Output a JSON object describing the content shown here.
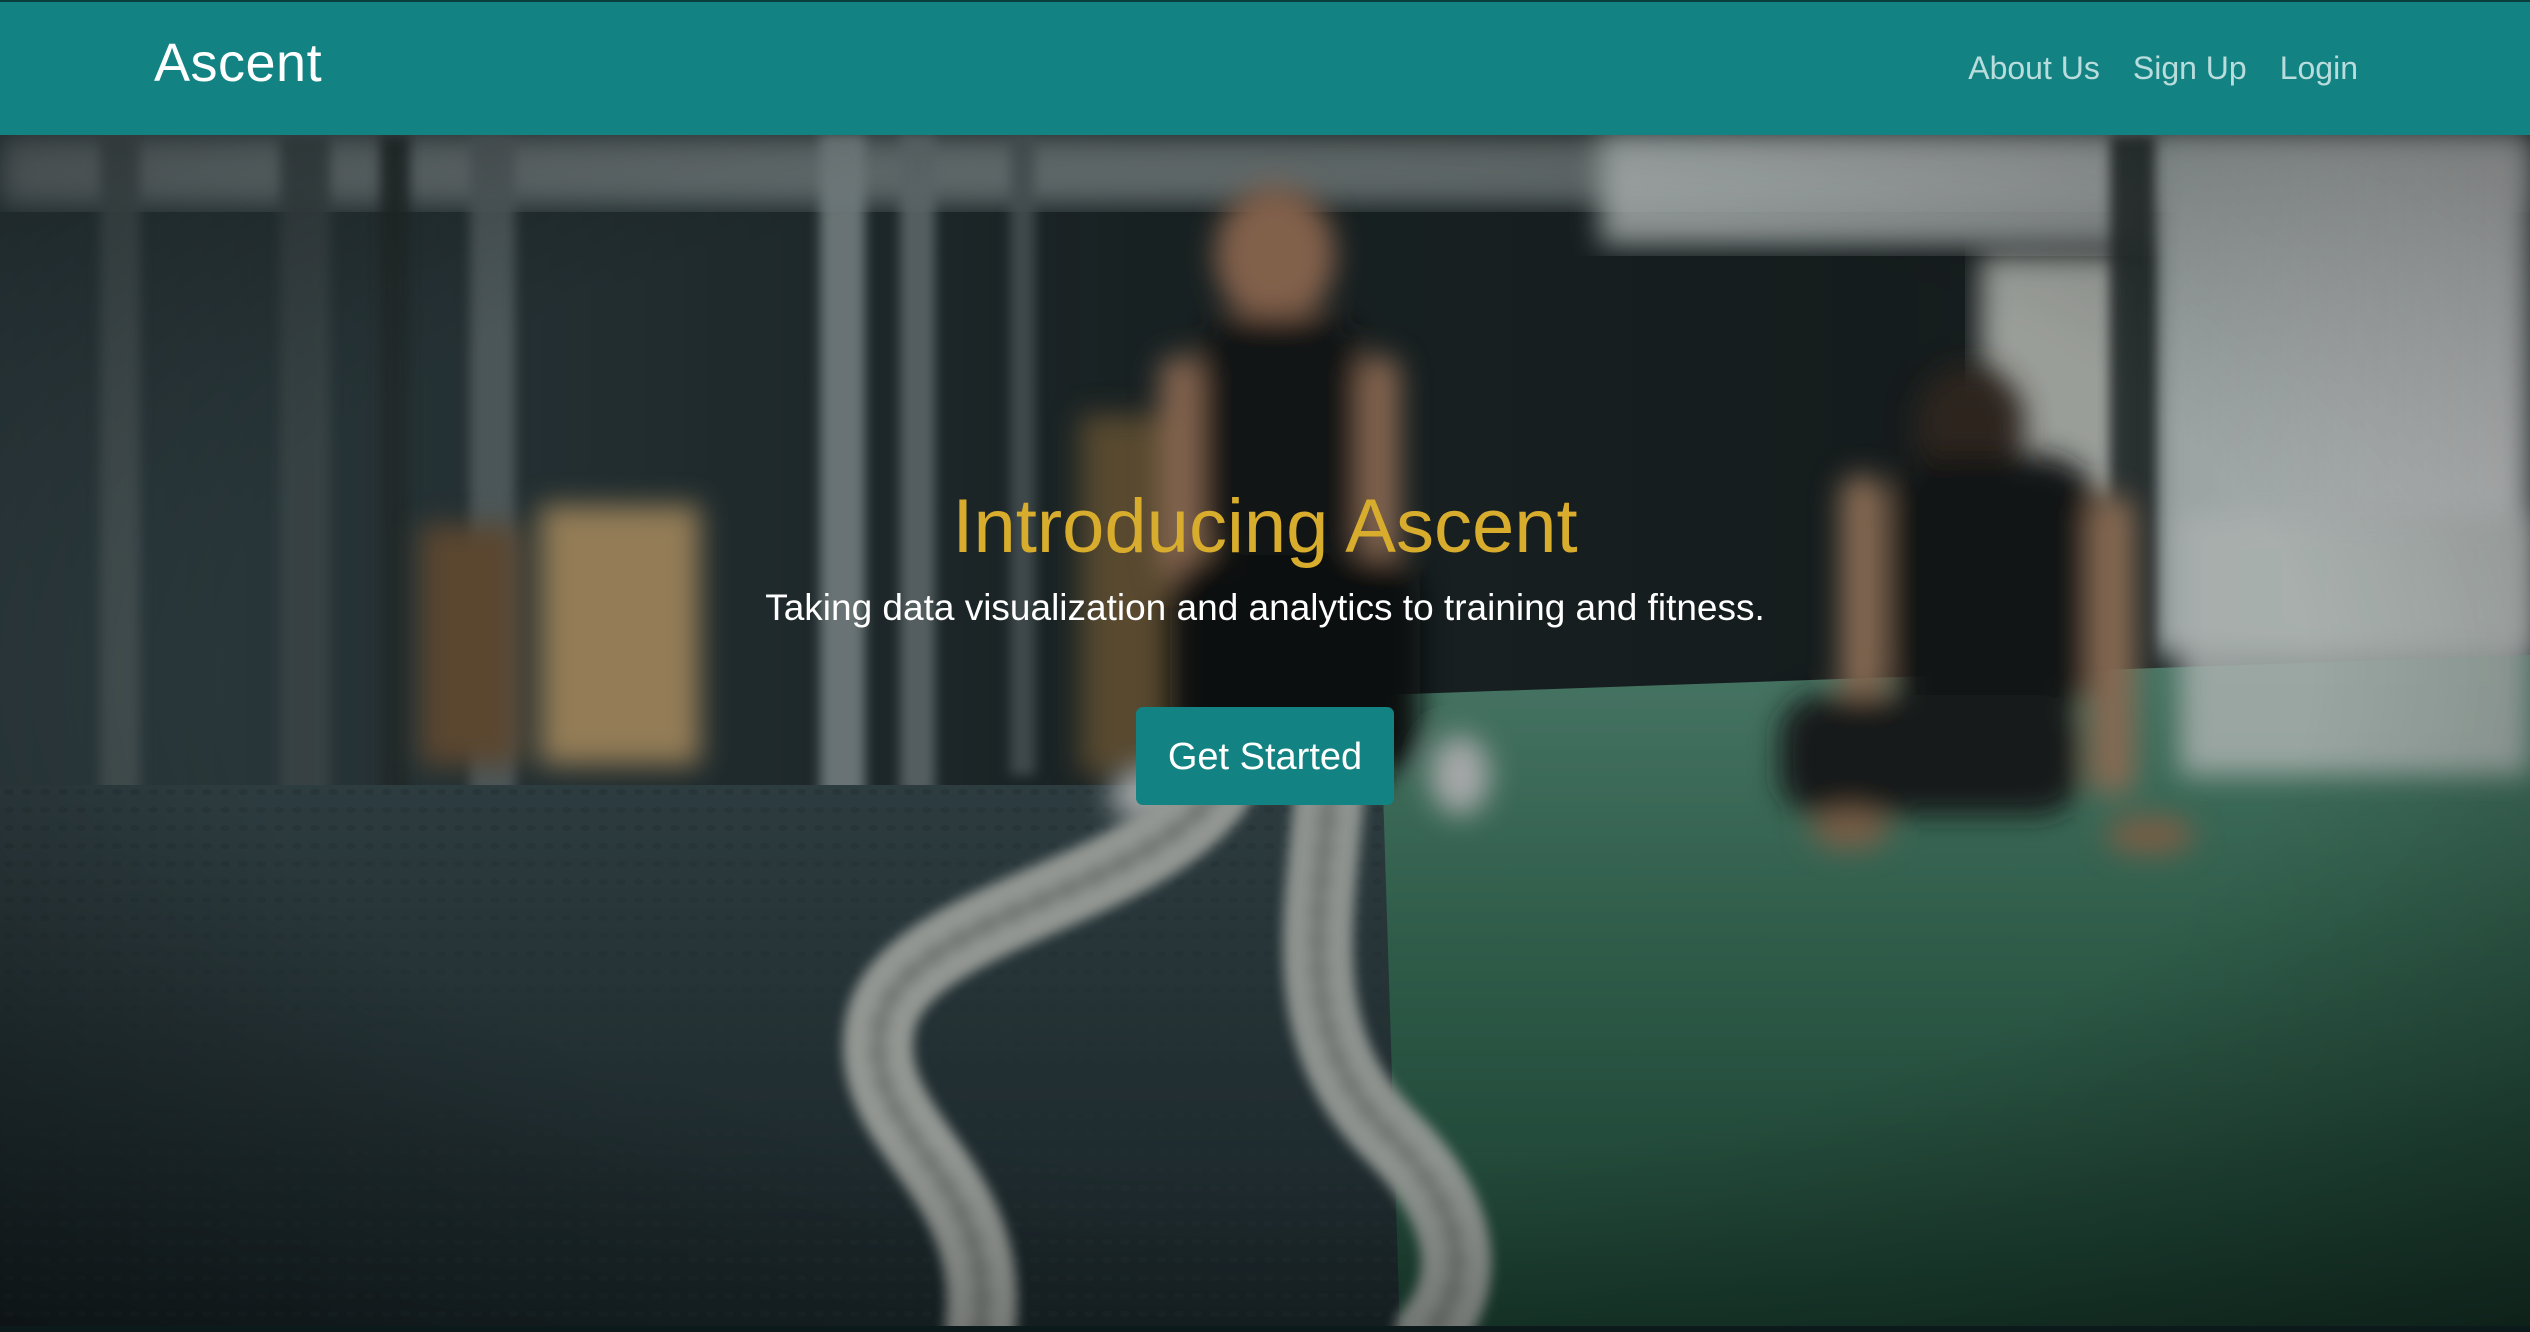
{
  "navbar": {
    "brand": "Ascent",
    "links": [
      "About Us",
      "Sign Up",
      "Login"
    ]
  },
  "hero": {
    "title": "Introducing Ascent",
    "subtitle": "Taking data visualization and analytics to training and fitness.",
    "cta_label": "Get Started"
  },
  "colors": {
    "primary": "#128282",
    "accent": "#d8ac2c",
    "text_light": "#ffffff",
    "nav_link": "#b9dcdc"
  }
}
